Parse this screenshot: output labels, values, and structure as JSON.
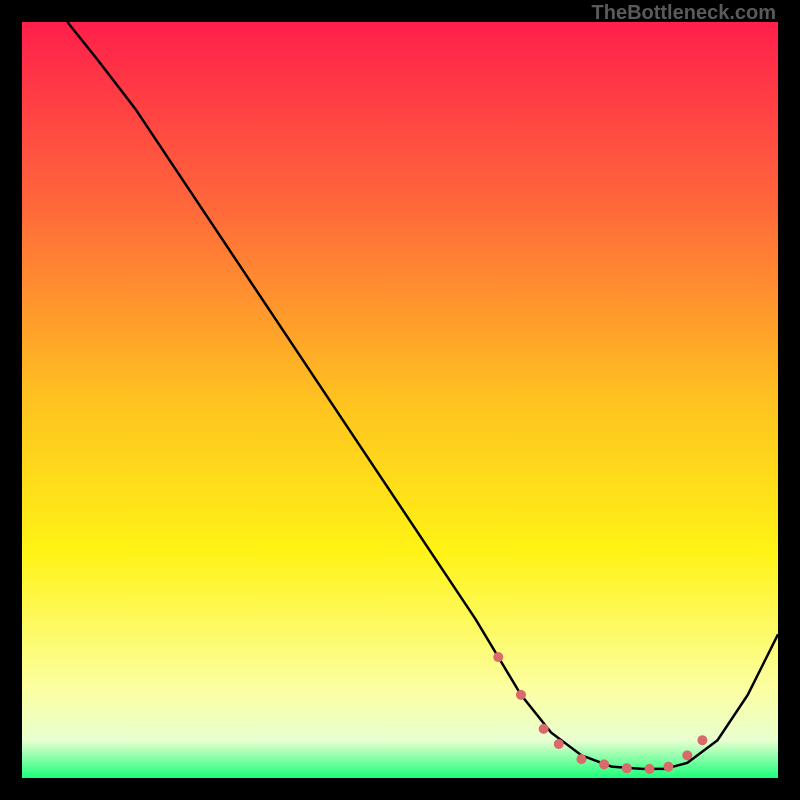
{
  "watermark": "TheBottleneck.com",
  "chart_data": {
    "type": "line",
    "title": "",
    "xlabel": "",
    "ylabel": "",
    "xlim": [
      0,
      100
    ],
    "ylim": [
      0,
      100
    ],
    "background_gradient": {
      "stops": [
        {
          "pos": 0,
          "color": "#ff1f4b"
        },
        {
          "pos": 25,
          "color": "#ff6a3a"
        },
        {
          "pos": 50,
          "color": "#ffc220"
        },
        {
          "pos": 70,
          "color": "#fff315"
        },
        {
          "pos": 88,
          "color": "#fcffa0"
        },
        {
          "pos": 95,
          "color": "#e9ffd0"
        },
        {
          "pos": 100,
          "color": "#1bff7a"
        }
      ]
    },
    "series": [
      {
        "name": "bottleneck-curve",
        "color": "#000000",
        "width": 2.5,
        "x": [
          6,
          10,
          15,
          20,
          25,
          30,
          35,
          40,
          45,
          50,
          55,
          60,
          63,
          66,
          70,
          74,
          78,
          82,
          85,
          88,
          92,
          96,
          100
        ],
        "values": [
          100,
          95,
          88.5,
          81,
          73.5,
          66,
          58.5,
          51,
          43.5,
          36,
          28.5,
          21,
          16,
          11,
          6,
          3,
          1.5,
          1.2,
          1.2,
          2,
          5,
          11,
          19
        ]
      }
    ],
    "markers": {
      "name": "optimal-zone-dots",
      "color": "#d86a6a",
      "radius": 5,
      "points": [
        {
          "x": 63,
          "y": 16
        },
        {
          "x": 66,
          "y": 11
        },
        {
          "x": 69,
          "y": 6.5
        },
        {
          "x": 71,
          "y": 4.5
        },
        {
          "x": 74,
          "y": 2.5
        },
        {
          "x": 77,
          "y": 1.8
        },
        {
          "x": 80,
          "y": 1.3
        },
        {
          "x": 83,
          "y": 1.2
        },
        {
          "x": 85.5,
          "y": 1.5
        },
        {
          "x": 88,
          "y": 3
        },
        {
          "x": 90,
          "y": 5
        }
      ]
    }
  }
}
